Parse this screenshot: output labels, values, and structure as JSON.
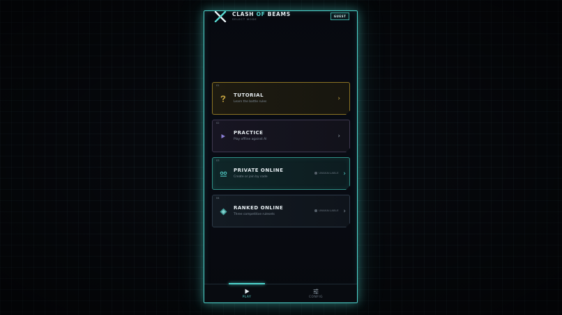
{
  "header": {
    "title_part1": "CLASH ",
    "title_accent": "OF",
    "title_part2": " BEAMS",
    "subtitle": "SELECT MODE",
    "guest_label": "GUEST"
  },
  "modes": [
    {
      "number": "01",
      "name": "TUTORIAL",
      "description": "Learn the battle rules",
      "icon": "question-mark-icon",
      "status": ""
    },
    {
      "number": "02",
      "name": "PRACTICE",
      "description": "Play offline against AI",
      "icon": "play-icon",
      "status": ""
    },
    {
      "number": "03",
      "name": "PRIVATE ONLINE",
      "description": "Create or join by code",
      "icon": "link-icon",
      "status": "UNAVAILABLE"
    },
    {
      "number": "04",
      "name": "RANKED ONLINE",
      "description": "Three competitive rulesets",
      "icon": "diamond-icon",
      "status": "UNAVAILABLE"
    }
  ],
  "nav": {
    "active": "play",
    "items": [
      {
        "id": "play",
        "label": "PLAY",
        "icon": "play-icon"
      },
      {
        "id": "config",
        "label": "CONFIG",
        "icon": "sliders-icon"
      }
    ]
  },
  "colors": {
    "accent": "#4fd6cf",
    "tutorial": "#c9a741",
    "practice": "#8b7fd6",
    "background": "#06080c"
  }
}
